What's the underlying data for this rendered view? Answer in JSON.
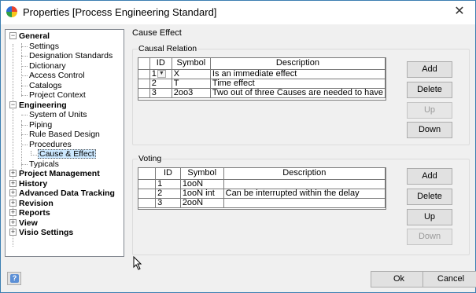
{
  "window": {
    "title": "Properties [Process Engineering Standard]",
    "close_glyph": "✕"
  },
  "tree": {
    "items": [
      {
        "label": "General",
        "bold": true,
        "expander": "−"
      },
      {
        "label": "Settings"
      },
      {
        "label": "Designation Standards"
      },
      {
        "label": "Dictionary"
      },
      {
        "label": "Access Control"
      },
      {
        "label": "Catalogs"
      },
      {
        "label": "Project Context"
      },
      {
        "label": "Engineering",
        "bold": true,
        "expander": "−"
      },
      {
        "label": "System of Units"
      },
      {
        "label": "Piping"
      },
      {
        "label": "Rule Based Design"
      },
      {
        "label": "Procedures",
        "expander": "−"
      },
      {
        "label": "Cause & Effect",
        "selected": true
      },
      {
        "label": "Typicals"
      },
      {
        "label": "Project Management",
        "bold": true,
        "expander": "+"
      },
      {
        "label": "History",
        "bold": true,
        "expander": "+"
      },
      {
        "label": "Advanced Data Tracking",
        "bold": true,
        "expander": "+"
      },
      {
        "label": "Revision",
        "bold": true,
        "expander": "+"
      },
      {
        "label": "Reports",
        "bold": true,
        "expander": "+"
      },
      {
        "label": "View",
        "bold": true,
        "expander": "+"
      },
      {
        "label": "Visio Settings",
        "bold": true,
        "expander": "+"
      }
    ]
  },
  "section_title": "Cause  Effect",
  "causal": {
    "title": "Causal Relation",
    "columns": [
      "ID",
      "Symbol",
      "Description"
    ],
    "rows": [
      [
        "1",
        "X",
        "Is an immediate effect"
      ],
      [
        "2",
        "T",
        "Time effect"
      ],
      [
        "3",
        "2oo3",
        "Two out of three Causes are needed to have"
      ]
    ],
    "buttons": {
      "add": "Add",
      "delete": "Delete",
      "up": "Up",
      "down": "Down"
    }
  },
  "voting": {
    "title": "Voting",
    "columns": [
      "ID",
      "Symbol",
      "Description"
    ],
    "rows": [
      [
        "1",
        "1ooN",
        ""
      ],
      [
        "2",
        "1ooN int",
        "Can be interrupted within the delay"
      ],
      [
        "3",
        "2ooN",
        ""
      ]
    ],
    "buttons": {
      "add": "Add",
      "delete": "Delete",
      "up": "Up",
      "down": "Down"
    }
  },
  "footer": {
    "ok": "Ok",
    "cancel": "Cancel",
    "help_glyph": "?"
  }
}
